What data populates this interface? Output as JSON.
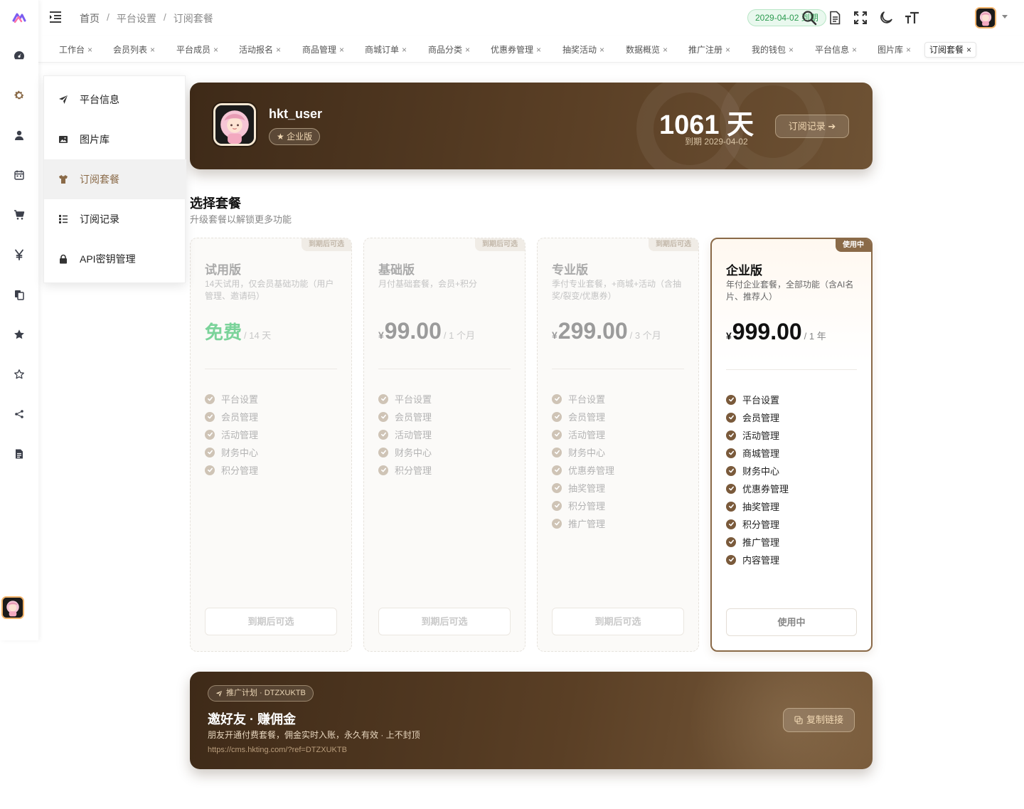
{
  "colors": {
    "brand": "#8a6a48",
    "banner_dark": "#3e2a18",
    "expire_green": "#2b9a4f",
    "free_green": "#7bd39a"
  },
  "rail": {
    "icons": [
      "logo-icon",
      "dashboard-icon",
      "gear-icon",
      "user-icon",
      "calendar-icon",
      "cart-icon",
      "yen-icon",
      "copy-icon",
      "star-filled-icon",
      "star-outline-icon",
      "share-icon",
      "document-icon"
    ]
  },
  "header": {
    "breadcrumb": [
      "首页",
      "平台设置",
      "订阅套餐"
    ],
    "breadcrumb_sep": "/",
    "expire_badge": "2029-04-02 到期"
  },
  "tabs": [
    {
      "label": "工作台"
    },
    {
      "label": "会员列表"
    },
    {
      "label": "平台成员"
    },
    {
      "label": "活动报名"
    },
    {
      "label": "商品管理"
    },
    {
      "label": "商城订单"
    },
    {
      "label": "商品分类"
    },
    {
      "label": "优惠券管理"
    },
    {
      "label": "抽奖活动"
    },
    {
      "label": "数据概览"
    },
    {
      "label": "推广注册"
    },
    {
      "label": "我的钱包"
    },
    {
      "label": "平台信息"
    },
    {
      "label": "图片库"
    },
    {
      "label": "订阅套餐"
    }
  ],
  "tab_close": "×",
  "submenu": [
    {
      "label": "平台信息",
      "icon": "send-icon"
    },
    {
      "label": "图片库",
      "icon": "image-icon"
    },
    {
      "label": "订阅套餐",
      "icon": "shirt-icon"
    },
    {
      "label": "订阅记录",
      "icon": "list-icon"
    },
    {
      "label": "API密钥管理",
      "icon": "lock-icon"
    }
  ],
  "hero": {
    "username": "hkt_user",
    "plan_tag": "企业版",
    "days": "1061 天",
    "expire": "到期 2029-04-02",
    "records_button": "订阅记录"
  },
  "section": {
    "title": "选择套餐",
    "subtitle": "升级套餐以解锁更多功能"
  },
  "plans": [
    {
      "badge": "到期后可选",
      "name": "试用版",
      "desc": "14天试用，仅会员基础功能（用户管理、邀请码）",
      "currency": "",
      "price": "免费",
      "period": "/ 14 天",
      "features": [
        "平台设置",
        "会员管理",
        "活动管理",
        "财务中心",
        "积分管理"
      ],
      "button": "到期后可选"
    },
    {
      "badge": "到期后可选",
      "name": "基础版",
      "desc": "月付基础套餐，会员+积分",
      "currency": "¥",
      "price": "99.00",
      "period": "/ 1 个月",
      "features": [
        "平台设置",
        "会员管理",
        "活动管理",
        "财务中心",
        "积分管理"
      ],
      "button": "到期后可选"
    },
    {
      "badge": "到期后可选",
      "name": "专业版",
      "desc": "季付专业套餐，+商城+活动（含抽奖/裂变/优惠券）",
      "currency": "¥",
      "price": "299.00",
      "period": "/ 3 个月",
      "features": [
        "平台设置",
        "会员管理",
        "活动管理",
        "财务中心",
        "优惠券管理",
        "抽奖管理",
        "积分管理",
        "推广管理"
      ],
      "button": "到期后可选"
    },
    {
      "badge": "使用中",
      "name": "企业版",
      "desc": "年付企业套餐，全部功能（含AI名片、推荐人）",
      "currency": "¥",
      "price": "999.00",
      "period": "/ 1 年",
      "features": [
        "平台设置",
        "会员管理",
        "活动管理",
        "商城管理",
        "财务中心",
        "优惠券管理",
        "抽奖管理",
        "积分管理",
        "推广管理",
        "内容管理"
      ],
      "button": "使用中",
      "current": true
    }
  ],
  "referral": {
    "chip": "推广计划 · DTZXUKTB",
    "title": "邀好友 · 赚佣金",
    "desc": "朋友开通付费套餐，佣金实时入账，永久有效 · 上不封顶",
    "link": "https://cms.hkting.com/?ref=DTZXUKTB",
    "copy_button": "复制链接"
  }
}
